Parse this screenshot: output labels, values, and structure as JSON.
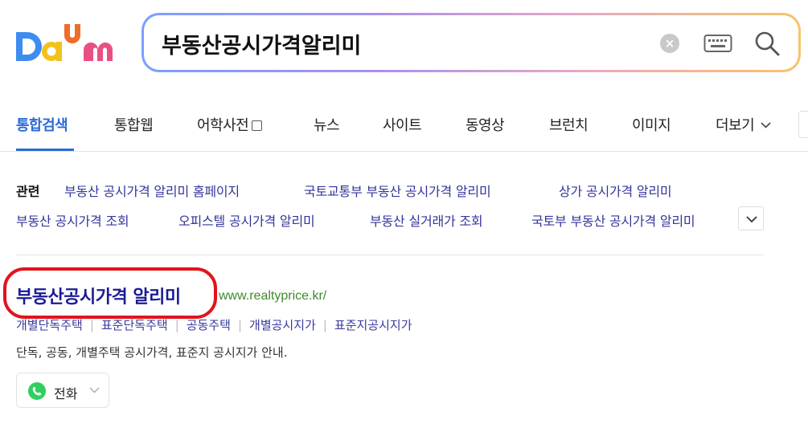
{
  "header": {
    "logo_text": "Daum",
    "search": {
      "value": "부동산공시가격알리미",
      "placeholder": ""
    },
    "clear_label": "×"
  },
  "tabs": [
    {
      "label": "통합검색",
      "active": true
    },
    {
      "label": "통합웹"
    },
    {
      "label": "어학사전"
    },
    {
      "label": "뉴스"
    },
    {
      "label": "사이트"
    },
    {
      "label": "동영상"
    },
    {
      "label": "브런치"
    },
    {
      "label": "이미지"
    },
    {
      "label": "더보기"
    }
  ],
  "related": {
    "label": "관련",
    "row1": [
      "부동산 공시가격 알리미 홈페이지",
      "국토교통부 부동산 공시가격 알리미",
      "상가 공시가격 알리미"
    ],
    "row2": [
      "부동산 공시가격 조회",
      "오피스텔 공시가격 알리미",
      "부동산 실거래가 조회",
      "국토부 부동산 공시가격 알리미"
    ]
  },
  "result": {
    "title": "부동산공시가격 알리미",
    "url": "www.realtyprice.kr/",
    "sublinks": [
      "개별단독주택",
      "표준단독주택",
      "공동주택",
      "개별공시지가",
      "표준지공시지가"
    ],
    "description": "단독, 공동, 개별주택 공시가격, 표준지 공시지가 안내.",
    "call_label": "전화"
  },
  "colors": {
    "brand_blue": "#2b6bd6",
    "link": "#34349c",
    "title": "#1b1b94",
    "url_green": "#3f8a2e",
    "highlight_red": "#e0141d",
    "phone_green": "#2fcf5f"
  }
}
